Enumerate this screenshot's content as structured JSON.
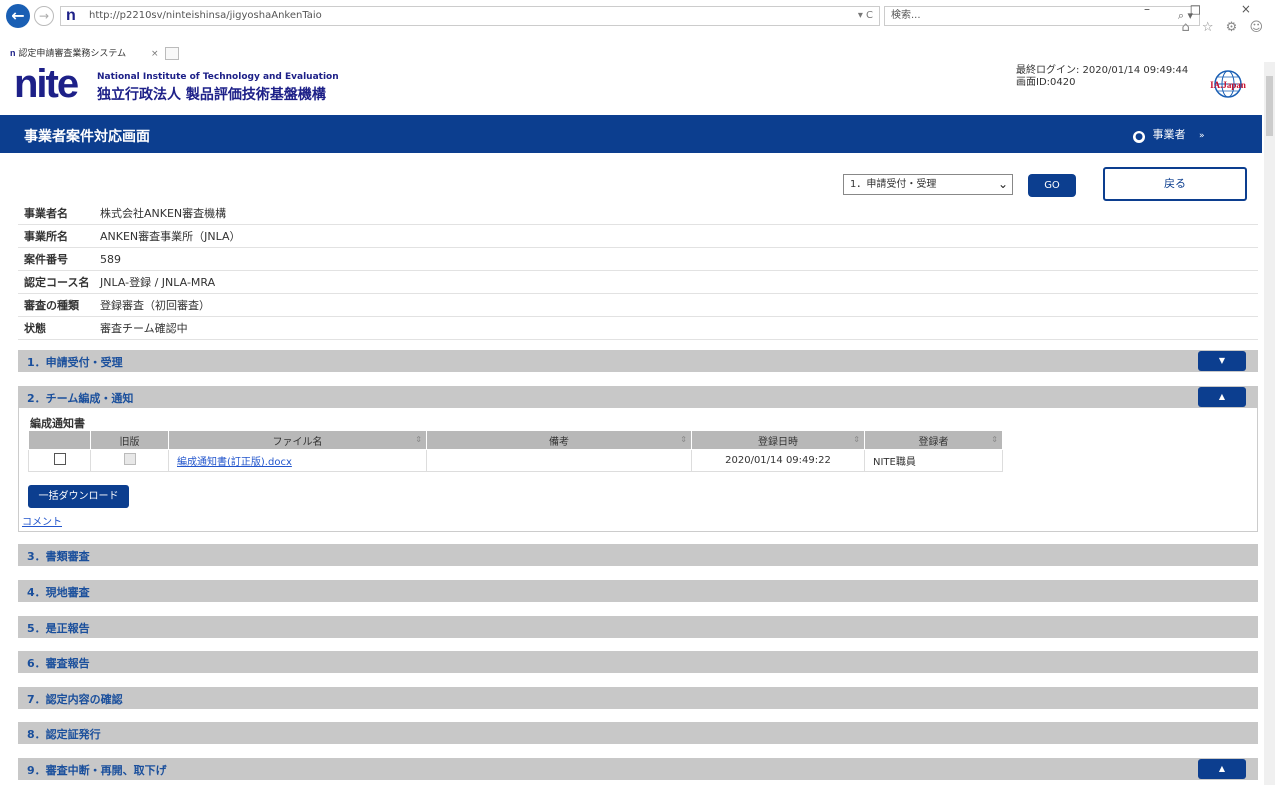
{
  "browser": {
    "url": "http://p2210sv/ninteishinsa/jigyoshaAnkenTaio",
    "addr_controls": "▾ C",
    "search_placeholder": "検索...",
    "tab_title": "認定申請審査業務システム",
    "tab_close": "×",
    "window_controls": "– □ ×",
    "toolbar_icons": "⌂ ☆ ⚙ ☺"
  },
  "header": {
    "logo": "nite",
    "org_en": "National Institute of Technology and Evaluation",
    "org_ja": "独立行政法人 製品評価技術基盤機構",
    "last_login": "最終ログイン: 2020/01/14 09:49:44",
    "screen_id": "画面ID:0420",
    "badge": "IA.Japan"
  },
  "titlebar": {
    "title": "事業者案件対応画面",
    "user_label": "事業者",
    "user_caret": "»"
  },
  "controls": {
    "step_selected": "1．申請受付・受理",
    "go_label": "GO",
    "back_label": "戻る"
  },
  "info": [
    {
      "label": "事業者名",
      "value": "株式会社ANKEN審査機構"
    },
    {
      "label": "事業所名",
      "value": "ANKEN審査事業所（JNLA）"
    },
    {
      "label": "案件番号",
      "value": "589"
    },
    {
      "label": "認定コース名",
      "value": "JNLA-登録 / JNLA-MRA"
    },
    {
      "label": "審査の種類",
      "value": "登録審査（初回審査）"
    },
    {
      "label": "状態",
      "value": "審査チーム確認中"
    }
  ],
  "sections": [
    {
      "label": "1．申請受付・受理",
      "toggle": "▼"
    },
    {
      "label": "2．チーム編成・通知",
      "toggle": "▲"
    },
    {
      "label": "3．書類審査"
    },
    {
      "label": "4．現地審査"
    },
    {
      "label": "5．是正報告"
    },
    {
      "label": "6．審査報告"
    },
    {
      "label": "7．認定内容の確認"
    },
    {
      "label": "8．認定証発行"
    },
    {
      "label": "9．審査中断・再開、取下げ",
      "toggle": "▲"
    }
  ],
  "section2": {
    "doc_title": "編成通知書",
    "columns": [
      "",
      "旧版",
      "ファイル名",
      "備考",
      "登録日時",
      "登録者"
    ],
    "rows": [
      {
        "file": "編成通知書(訂正版).docx",
        "note": "",
        "date": "2020/01/14 09:49:22",
        "user": "NITE職員"
      }
    ],
    "download_label": "一括ダウンロード",
    "comment_label": "コメント"
  }
}
